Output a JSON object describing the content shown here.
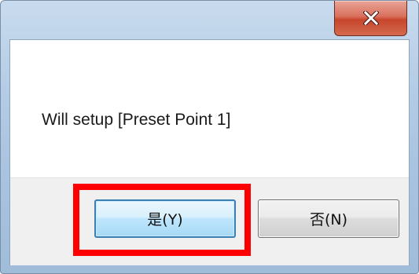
{
  "dialog": {
    "message": "Will setup [Preset Point 1]",
    "close_icon": "close-icon",
    "buttons": {
      "yes_label": "是(Y)",
      "no_label": "否(N)"
    },
    "highlight_color": "#ff0000"
  }
}
